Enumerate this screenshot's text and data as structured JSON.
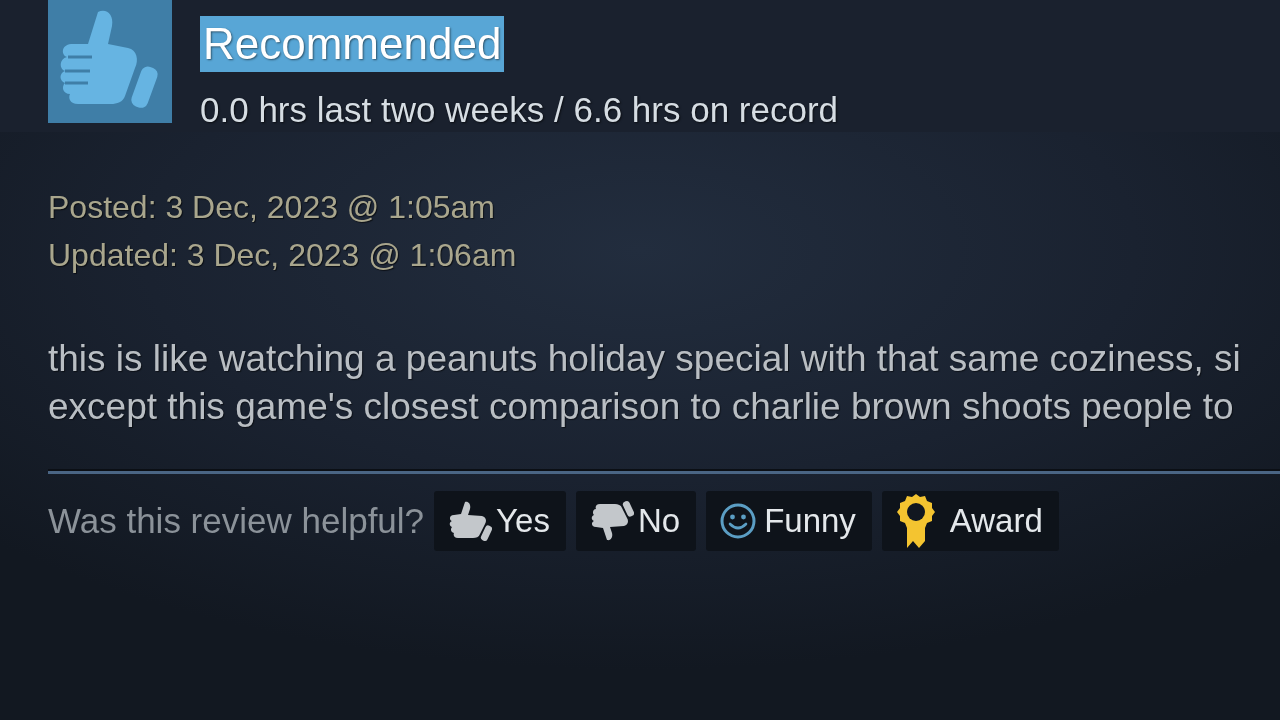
{
  "review": {
    "verdict": {
      "label": "Recommended",
      "text_selected": true
    },
    "playtime": "0.0 hrs last two weeks / 6.6 hrs on record",
    "posted": "Posted: 3 Dec, 2023 @ 1:05am",
    "updated": "Updated: 3 Dec, 2023 @ 1:06am",
    "text_lines": [
      "this is like watching a peanuts holiday special with that same coziness, si",
      "except this game's closest comparison to charlie brown shoots people to"
    ]
  },
  "feedback": {
    "prompt": "Was this review helpful?",
    "buttons": [
      {
        "kind": "yes",
        "label": "Yes"
      },
      {
        "kind": "no",
        "label": "No"
      },
      {
        "kind": "funny",
        "label": "Funny"
      },
      {
        "kind": "award",
        "label": "Award"
      }
    ]
  }
}
